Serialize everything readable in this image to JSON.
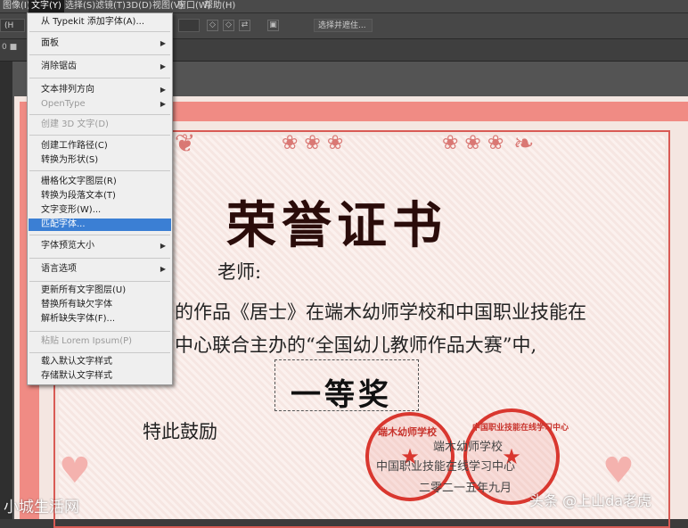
{
  "menubar": {
    "items": [
      "图像(I)",
      "文字(Y)",
      "选择(S)",
      "滤镜(T)",
      "3D(D)",
      "视图(V)",
      "窗口(W)",
      "帮助(H)"
    ],
    "active_index": 1
  },
  "options": {
    "font_box": "(H",
    "size_box": "",
    "right_button": "选择并遮住...",
    "small_icons": [
      "◇",
      "◇",
      "⇄",
      "▣"
    ]
  },
  "tab_small": "0 ■",
  "menu": {
    "items": [
      {
        "label": "从 Typekit 添加字体(A)...",
        "submenu": false,
        "disabled": false
      },
      {
        "label": "面板",
        "submenu": true,
        "disabled": false
      },
      {
        "label": "消除锯齿",
        "submenu": true,
        "disabled": false
      },
      {
        "label": "文本排列方向",
        "submenu": true,
        "disabled": false
      },
      {
        "label": "OpenType",
        "submenu": true,
        "disabled": true
      },
      {
        "label": "创建 3D 文字(D)",
        "submenu": false,
        "disabled": true
      },
      {
        "label": "创建工作路径(C)",
        "submenu": false,
        "disabled": false
      },
      {
        "label": "转换为形状(S)",
        "submenu": false,
        "disabled": false
      },
      {
        "label": "栅格化文字图层(R)",
        "submenu": false,
        "disabled": false
      },
      {
        "label": "转换为段落文本(T)",
        "submenu": false,
        "disabled": false
      },
      {
        "label": "文字变形(W)...",
        "submenu": false,
        "disabled": false
      },
      {
        "label": "匹配字体...",
        "submenu": false,
        "disabled": false,
        "highlighted": true
      },
      {
        "label": "字体预览大小",
        "submenu": true,
        "disabled": false
      },
      {
        "label": "语言选项",
        "submenu": true,
        "disabled": false
      },
      {
        "label": "更新所有文字图层(U)",
        "submenu": false,
        "disabled": false
      },
      {
        "label": "替换所有缺欠字体",
        "submenu": false,
        "disabled": false
      },
      {
        "label": "解析缺失字体(F)...",
        "submenu": false,
        "disabled": false
      },
      {
        "label": "粘贴 Lorem Ipsum(P)",
        "submenu": false,
        "disabled": true
      },
      {
        "label": "载入默认文字样式",
        "submenu": false,
        "disabled": false
      },
      {
        "label": "存储默认文字样式",
        "submenu": false,
        "disabled": false
      }
    ]
  },
  "certificate": {
    "title": "荣誉证书",
    "salutation": "老师:",
    "line1": "的作品《居士》在端木幼师学校和中国职业技能在",
    "line2": "中心联合主办的“全国幼儿教师作品大赛”中,",
    "award": "一等奖",
    "closing": "特此鼓励",
    "issuer1": "端木幼师学校",
    "issuer2": "中国职业技能在线学习中心",
    "date": "二零二一五年九月",
    "stamp_left_text": "端木幼师学校",
    "stamp_right_text": "中国职业技能在线学习中心"
  },
  "watermarks": {
    "left": "小城生活网",
    "right": "头条 @上山da老虎"
  },
  "colors": {
    "accent": "#3b7fd4",
    "frame": "#f08b84",
    "stamp": "#d9372f"
  }
}
